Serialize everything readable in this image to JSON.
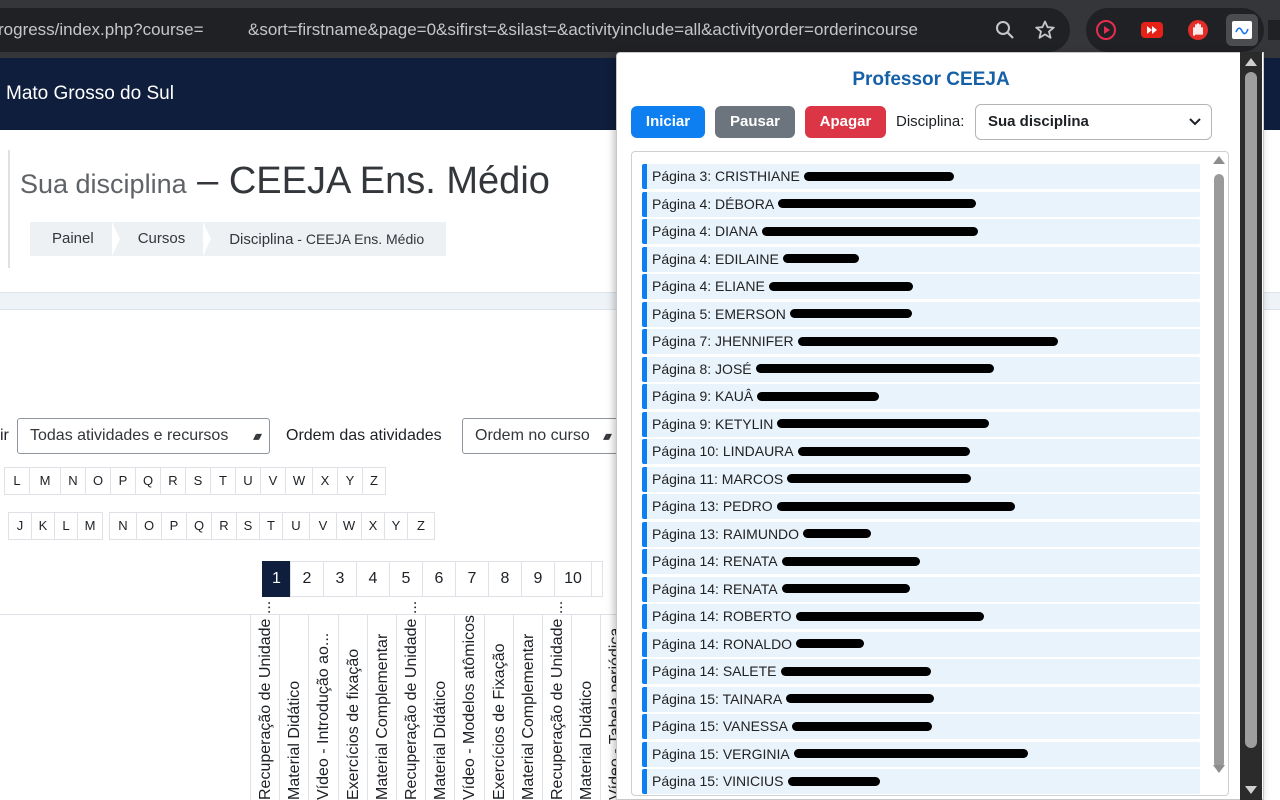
{
  "browser": {
    "url_part1": "rogress/index.php?course=",
    "url_part2": "&sort=firstname&page=0&sifirst=&silast=&activityinclude=all&activityorder=orderincourse",
    "icons": [
      "search-icon",
      "bookmark-star-icon"
    ],
    "extensions": [
      "screen-recorder-icon",
      "youtube-extension-icon",
      "hand-stop-icon",
      "active-extension-icon"
    ]
  },
  "site": {
    "name": "Mato Grosso do Sul"
  },
  "course": {
    "title_prefix": "Sua disciplina",
    "title_dash": " – ",
    "title_main": "CEEJA Ens. Médio"
  },
  "breadcrumb": {
    "items": [
      "Painel",
      "Cursos"
    ],
    "current": "Disciplina",
    "current_sub": " - CEEJA Ens. Médio"
  },
  "filters": {
    "include_label_partial": "ir",
    "include_value": "Todas atividades e recursos",
    "order_label": "Ordem das atividades",
    "order_value": "Ordem no curso"
  },
  "alpha_rows": [
    [
      "",
      "L",
      "M",
      "N",
      "O",
      "P",
      "Q",
      "R",
      "S",
      "T",
      "U",
      "V",
      "W",
      "X",
      "Y",
      "Z"
    ],
    [
      "",
      "J",
      "K",
      "L",
      "M",
      "N",
      "O",
      "P",
      "Q",
      "R",
      "S",
      "T",
      "U",
      "V",
      "W",
      "X",
      "Y",
      "Z"
    ]
  ],
  "pagination": {
    "pages": [
      "1",
      "2",
      "3",
      "4",
      "5",
      "6",
      "7",
      "8",
      "9",
      "10"
    ],
    "current": "1"
  },
  "activity_columns": [
    "Recuperação de Unidade ...",
    "Material Didático",
    "Vídeo - Introdução ao...",
    "Exercícios de fixação",
    "Material Complementar",
    "Recuperação de Unidade ...",
    "Material Didático",
    "Vídeo - Modelos atômicos",
    "Exercícios de Fixação",
    "Material Complementar",
    "Recuperação de Unidade ...",
    "Material Didático",
    "Vídeo - Tabela periódica"
  ],
  "popup": {
    "title": "Professor CEEJA",
    "buttons": {
      "start": "Iniciar",
      "pause": "Pausar",
      "clear": "Apagar"
    },
    "discipline_label": "Disciplina:",
    "discipline_value": "Sua disciplina",
    "colors": {
      "start": "#0d7ff0",
      "pause": "#6c757d",
      "clear": "#dc3545",
      "title": "#1660a8"
    },
    "entries": [
      "Página 3: CRISTHIANE",
      "Página 4: DÉBORA",
      "Página 4: DIANA",
      "Página 4: EDILAINE",
      "Página 4: ELIANE",
      "Página 5: EMERSON",
      "Página 7: JHENNIFER",
      "Página 8: JOSÉ",
      "Página 9: KAUÂ",
      "Página 9: KETYLIN",
      "Página 10: LINDAURA",
      "Página 11: MARCOS",
      "Página 13: PEDRO",
      "Página 13: RAIMUNDO",
      "Página 14: RENATA",
      "Página 14: RENATA",
      "Página 14: ROBERTO",
      "Página 14: RONALDO",
      "Página 14: SALETE",
      "Página 15: TAINARA",
      "Página 15: VANESSA",
      "Página 15: VERGINIA",
      "Página 15: VINICIUS"
    ]
  }
}
